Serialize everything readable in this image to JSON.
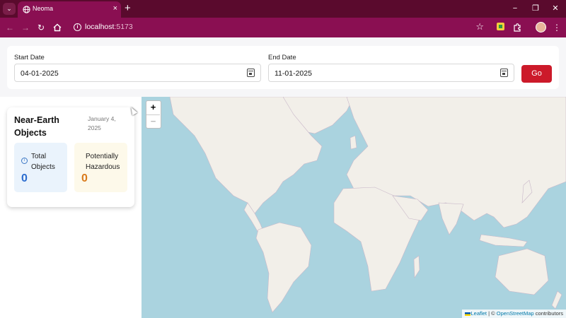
{
  "browser": {
    "tab_title": "Neoma",
    "tab_close": "×",
    "new_tab": "+",
    "url_host": "localhost",
    "url_port": ":5173",
    "icons": [
      "chevron-down-icon",
      "globe-icon",
      "back-icon",
      "forward-icon",
      "reload-icon",
      "home-icon",
      "info-icon",
      "star-icon",
      "extension-icon",
      "puzzle-icon",
      "avatar",
      "kebab-menu-icon",
      "minimize-icon",
      "restore-icon",
      "close-icon"
    ]
  },
  "form": {
    "start_label": "Start Date",
    "start_value": "04-01-2025",
    "end_label": "End Date",
    "end_value": "11-01-2025",
    "go_label": "Go"
  },
  "neo_card": {
    "title": "Near-Earth Objects",
    "date": "January 4, 2025",
    "total_label": "Total Objects",
    "total_value": "0",
    "hazard_label": "Potentially Hazardous",
    "hazard_value": "0",
    "total_color": "#2b6ccf",
    "hazard_color": "#d97a1a"
  },
  "map": {
    "zoom_in": "+",
    "zoom_out": "−",
    "attr_leaflet": "Leaflet",
    "attr_sep": " | © ",
    "attr_osm": "OpenStreetMap",
    "attr_tail": " contributors",
    "water_color": "#aad3df",
    "land_color": "#f2efe9"
  },
  "colors": {
    "chrome_dark": "#5a0a2d",
    "chrome": "#8a0f52",
    "go_button": "#cc1a2a"
  }
}
